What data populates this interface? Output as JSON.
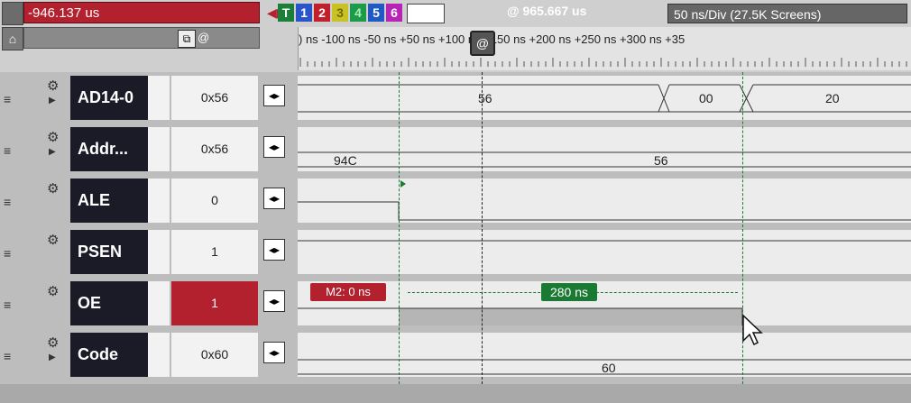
{
  "header": {
    "cursor_time": "-946.137 us",
    "at_time": "@ 965.667 us",
    "div_label": "50 ns/Div (27.5K Screens)",
    "ctl_label": "@",
    "markers": [
      "T",
      "1",
      "2",
      "3",
      "4",
      "5",
      "6"
    ]
  },
  "ruler": {
    "tick_labels": ") ns  -100 ns  -50 ns         +50 ns  +100 ns +150 ns +200 ns +250 ns +300 ns +35",
    "at_marker": "@"
  },
  "rows": [
    {
      "name": "AD14-0",
      "value": "0x56",
      "has_expand": true,
      "lane_labels": [
        "56",
        "00",
        "20"
      ]
    },
    {
      "name": "Addr...",
      "value": "0x56",
      "has_expand": true,
      "lane_labels": [
        "94C",
        "56"
      ]
    },
    {
      "name": "ALE",
      "value": "0",
      "has_expand": false,
      "lane_labels": []
    },
    {
      "name": "PSEN",
      "value": "1",
      "has_expand": false,
      "lane_labels": []
    },
    {
      "name": "OE",
      "value": "1",
      "has_expand": false,
      "highlight": true,
      "lane_labels": []
    },
    {
      "name": "Code",
      "value": "0x60",
      "has_expand": true,
      "lane_labels": [
        "60"
      ]
    }
  ],
  "measure": {
    "m2_label": "M2: 0 ns",
    "delta_label": "280 ns"
  },
  "colors": {
    "accent_red": "#b3202e",
    "name_bg": "#1b1b27",
    "cursor_green": "#1a7a34"
  },
  "icons": [
    "gear-icon",
    "expand-icon",
    "drag-handle-icon",
    "nav-arrows-icon",
    "mouse-pointer-icon"
  ]
}
